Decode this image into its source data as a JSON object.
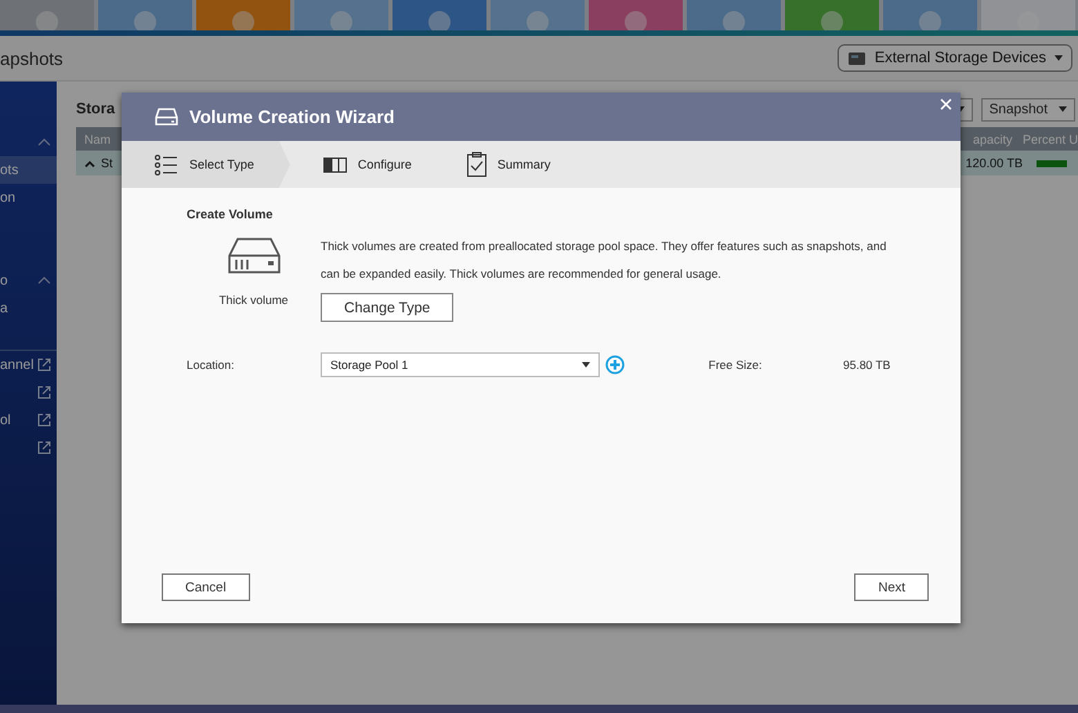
{
  "app": {
    "title": "apshots",
    "external_button": "External Storage Devices"
  },
  "sidebar": {
    "items": [
      {
        "label": "ots",
        "selected": true,
        "kind": "item"
      },
      {
        "label": "on",
        "selected": false,
        "kind": "item"
      },
      {
        "label": "o",
        "selected": false,
        "kind": "group"
      },
      {
        "label": "a",
        "selected": false,
        "kind": "item"
      },
      {
        "label": "annel",
        "selected": false,
        "kind": "link"
      },
      {
        "selected": false,
        "kind": "link"
      },
      {
        "label": "ol",
        "selected": false,
        "kind": "link"
      },
      {
        "selected": false,
        "kind": "link"
      }
    ]
  },
  "main": {
    "title": "Stora",
    "snapshot_button": "Snapshot",
    "columns": [
      "Nam",
      "apacity",
      "Percent U"
    ],
    "row": {
      "name": "St",
      "capacity": "120.00 TB",
      "expanded": true,
      "level": 1
    }
  },
  "wizard": {
    "title": "Volume Creation Wizard",
    "steps": [
      {
        "label": "Select Type",
        "selected": true,
        "kind": "list"
      },
      {
        "label": "Configure",
        "selected": false,
        "kind": "config"
      },
      {
        "label": "Summary",
        "selected": false,
        "kind": "clipboard"
      }
    ],
    "section": "Create Volume",
    "description": "Thick volumes are created from preallocated storage pool space. They offer features such as snapshots, and can be expanded easily. Thick volumes are recommended for general usage.",
    "type_label": "Thick volume",
    "change_button": "Change Type",
    "location_label": "Location:",
    "location_value": "Storage Pool 1",
    "free_label": "Free Size:",
    "free_value": "95.80 TB",
    "cancel": "Cancel",
    "next": "Next"
  }
}
